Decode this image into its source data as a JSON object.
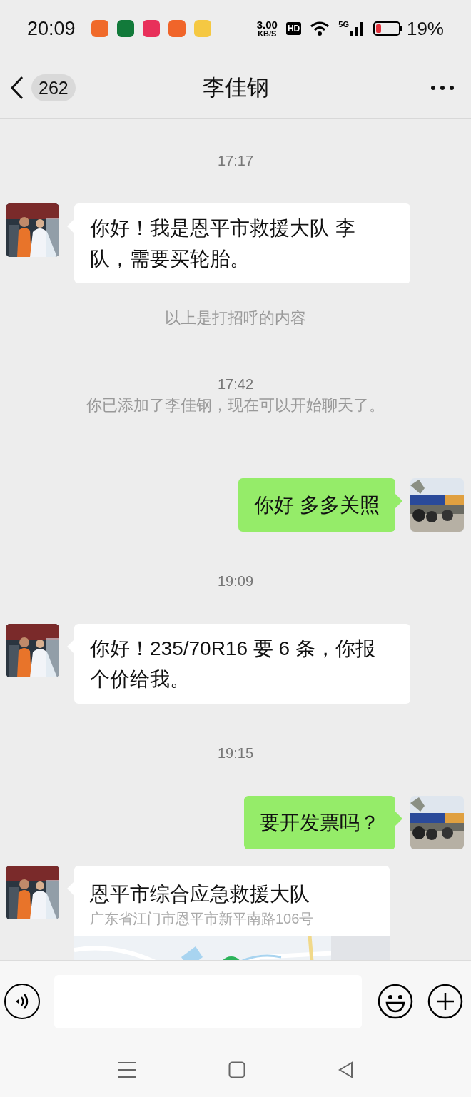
{
  "status_bar": {
    "time": "20:09",
    "apps": [
      {
        "color": "#f06a2a"
      },
      {
        "color": "#127a3a"
      },
      {
        "color": "#e8305a"
      },
      {
        "color": "#f0652a"
      },
      {
        "color": "#f5c842"
      }
    ],
    "speed_value": "3.00",
    "speed_unit": "KB/S",
    "hd_badge": "HD",
    "network": "5G",
    "battery_text": "19%"
  },
  "header": {
    "unread_count": "262",
    "title": "李佳钢"
  },
  "messages": [
    {
      "kind": "time",
      "text": "17:17"
    },
    {
      "kind": "incoming",
      "text": "你好！我是恩平市救援大队 李队，需要买轮胎。"
    },
    {
      "kind": "system",
      "text": "以上是打招呼的内容"
    },
    {
      "kind": "time",
      "text": "17:42"
    },
    {
      "kind": "system",
      "text": "你已添加了李佳钢，现在可以开始聊天了。"
    },
    {
      "kind": "outgoing",
      "text": "你好 多多关照"
    },
    {
      "kind": "time",
      "text": "19:09"
    },
    {
      "kind": "incoming",
      "text": "你好！235/70R16 要 6 条，你报个价给我。"
    },
    {
      "kind": "time",
      "text": "19:15"
    },
    {
      "kind": "outgoing",
      "text": "要开发票吗？"
    },
    {
      "kind": "location",
      "title": "恩平市综合应急救援大队",
      "address": "广东省江门市恩平市新平南路106号"
    }
  ]
}
